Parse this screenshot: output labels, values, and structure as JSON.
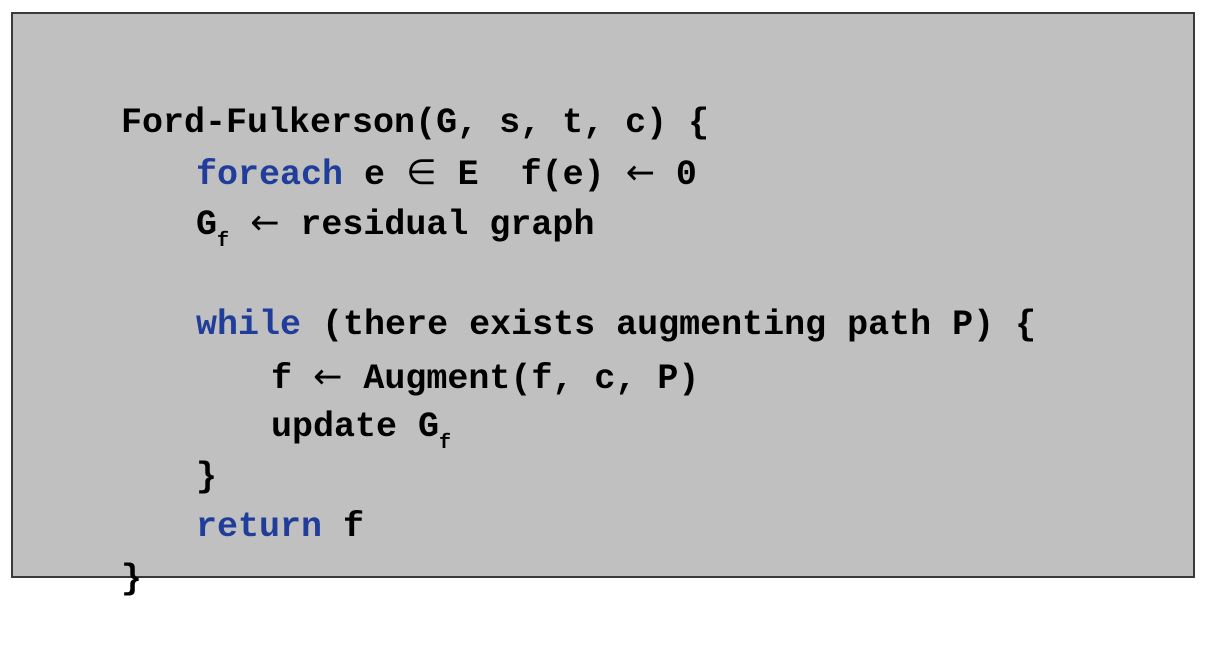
{
  "code": {
    "line1": "Ford-Fulkerson(G, s, t, c) {",
    "line2_keyword": "foreach",
    "line2_rest_a": " e ",
    "line2_symbol_in": "∈",
    "line2_rest_b": " E  f(e) ",
    "line2_arrow": "←",
    "line2_rest_c": " 0",
    "line3_var": "G",
    "line3_sub": "f",
    "line3_arrow": "←",
    "line3_rest": " residual graph",
    "line5_keyword": "while",
    "line5_rest": " (there exists augmenting path P) {",
    "line6_var": "f ",
    "line6_arrow": "←",
    "line6_rest": " Augment(f, c, P)",
    "line7_text": "update G",
    "line7_sub": "f",
    "line8_brace": "}",
    "line9_keyword": "return",
    "line9_rest": " f",
    "line10_brace": "}"
  },
  "colors": {
    "background": "#c0c0c0",
    "keyword": "#1f3d99",
    "text": "#000000",
    "border": "#3a3a3a"
  }
}
